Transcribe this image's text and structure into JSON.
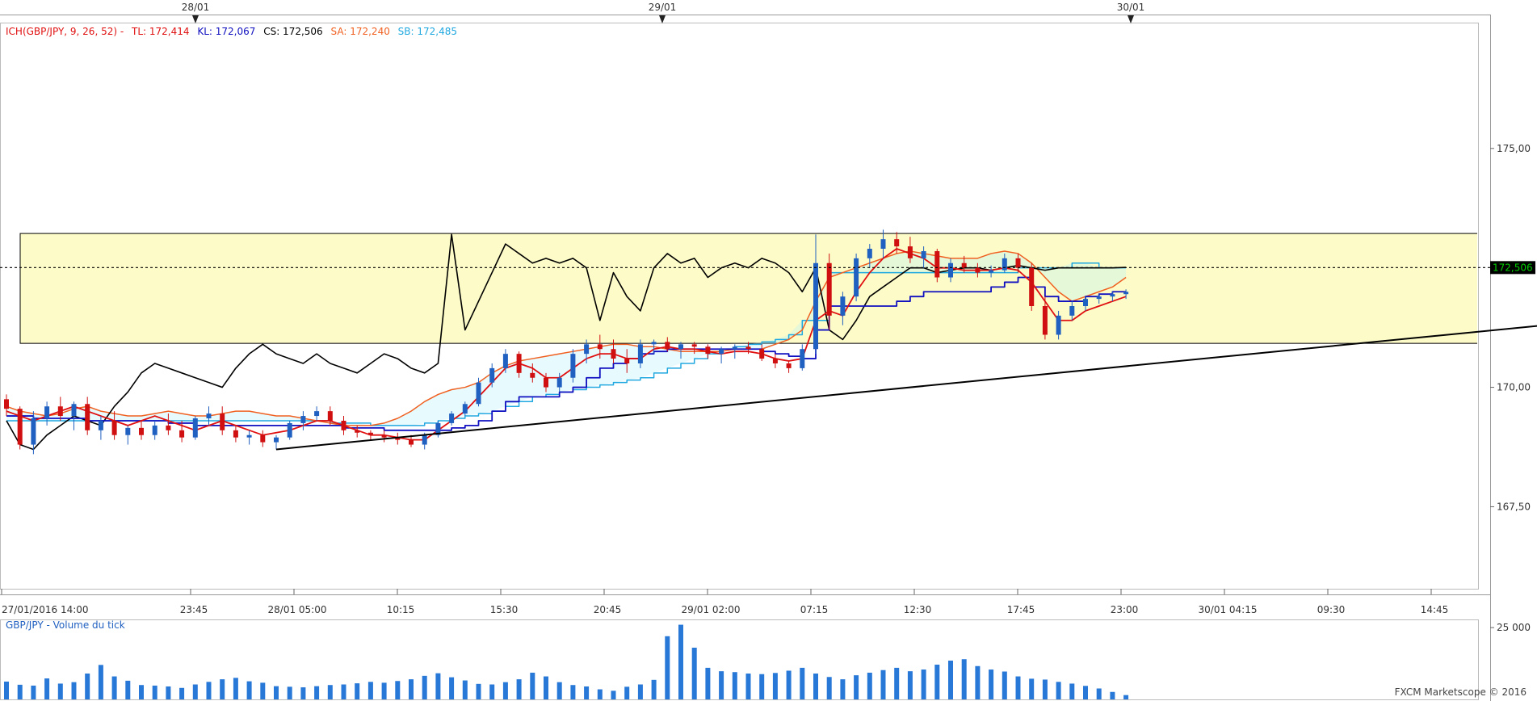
{
  "legend": {
    "ich": "ICH(GBP/JPY, 9, 26, 52) -",
    "tl": "TL: 172,414",
    "kl": "KL: 172,067",
    "cs": "CS: 172,506",
    "sa": "SA: 172,240",
    "sb": "SB: 172,485"
  },
  "colors": {
    "tenkan": "#e01010",
    "kijun": "#1010c0",
    "chikou": "#000000",
    "senkou_a": "#f06020",
    "senkou_b": "#20a8e0",
    "candle_up": "#2060c0",
    "candle_down": "#d01010",
    "zone_fill": "#fdfbc8",
    "price_tag": "#00cc00"
  },
  "volume_title": "GBP/JPY - Volume du tick",
  "credit": "FXCM Marketscope © 2016",
  "chart_data": {
    "type": "candlestick",
    "symbol": "GBP/JPY",
    "top_dates": [
      "28/01",
      "29/01",
      "30/01"
    ],
    "x_tick_labels": [
      "27/01/2016 14:00",
      "23:45",
      "28/01 05:00",
      "10:15",
      "15:30",
      "20:45",
      "29/01 02:00",
      "07:15",
      "12:30",
      "17:45",
      "23:00",
      "30/01 04:15",
      "09:30",
      "14:45"
    ],
    "y_tick_labels": [
      "175,00",
      "170,00",
      "167,50"
    ],
    "y_ticks": [
      175.0,
      170.0,
      167.5
    ],
    "ylim": [
      165.8,
      177.6
    ],
    "current_price": 172.506,
    "current_price_label": "172,506",
    "zone": [
      170.92,
      173.22
    ],
    "trendline": {
      "from": [
        20,
        168.7
      ],
      "to": [
        143,
        172.1
      ]
    },
    "candles": [
      [
        169.75,
        169.85,
        169.4,
        169.55
      ],
      [
        169.55,
        169.6,
        168.7,
        168.8
      ],
      [
        168.8,
        169.5,
        168.6,
        169.35
      ],
      [
        169.35,
        169.7,
        169.2,
        169.6
      ],
      [
        169.6,
        169.8,
        169.3,
        169.4
      ],
      [
        169.4,
        169.7,
        169.1,
        169.65
      ],
      [
        169.65,
        169.8,
        169.0,
        169.1
      ],
      [
        169.1,
        169.4,
        168.9,
        169.3
      ],
      [
        169.3,
        169.5,
        168.9,
        169.0
      ],
      [
        169.0,
        169.2,
        168.8,
        169.15
      ],
      [
        169.15,
        169.3,
        168.9,
        169.0
      ],
      [
        169.0,
        169.3,
        168.9,
        169.2
      ],
      [
        169.2,
        169.45,
        169.0,
        169.1
      ],
      [
        169.1,
        169.3,
        168.85,
        168.95
      ],
      [
        168.95,
        169.4,
        168.9,
        169.35
      ],
      [
        169.35,
        169.6,
        169.2,
        169.45
      ],
      [
        169.45,
        169.6,
        169.0,
        169.1
      ],
      [
        169.1,
        169.2,
        168.85,
        168.95
      ],
      [
        168.95,
        169.1,
        168.8,
        169.0
      ],
      [
        169.0,
        169.1,
        168.75,
        168.85
      ],
      [
        168.85,
        169.0,
        168.7,
        168.95
      ],
      [
        168.95,
        169.3,
        168.9,
        169.25
      ],
      [
        169.25,
        169.5,
        169.1,
        169.4
      ],
      [
        169.4,
        169.6,
        169.3,
        169.5
      ],
      [
        169.5,
        169.6,
        169.2,
        169.3
      ],
      [
        169.3,
        169.4,
        169.0,
        169.1
      ],
      [
        169.1,
        169.2,
        168.95,
        169.05
      ],
      [
        169.05,
        169.1,
        168.9,
        169.0
      ],
      [
        169.0,
        169.1,
        168.85,
        168.95
      ],
      [
        168.95,
        169.05,
        168.8,
        168.9
      ],
      [
        168.9,
        169.0,
        168.75,
        168.8
      ],
      [
        168.8,
        169.05,
        168.7,
        169.0
      ],
      [
        169.0,
        169.3,
        168.95,
        169.25
      ],
      [
        169.25,
        169.5,
        169.2,
        169.45
      ],
      [
        169.45,
        169.7,
        169.4,
        169.65
      ],
      [
        169.65,
        170.2,
        169.6,
        170.1
      ],
      [
        170.1,
        170.5,
        170.0,
        170.4
      ],
      [
        170.4,
        170.8,
        170.3,
        170.7
      ],
      [
        170.7,
        170.75,
        170.2,
        170.3
      ],
      [
        170.3,
        170.5,
        170.1,
        170.2
      ],
      [
        170.2,
        170.3,
        169.9,
        170.0
      ],
      [
        170.0,
        170.3,
        169.9,
        170.2
      ],
      [
        170.2,
        170.8,
        170.1,
        170.7
      ],
      [
        170.7,
        171.0,
        170.5,
        170.9
      ],
      [
        170.9,
        171.1,
        170.6,
        170.8
      ],
      [
        170.8,
        171.0,
        170.5,
        170.6
      ],
      [
        170.6,
        170.8,
        170.3,
        170.5
      ],
      [
        170.5,
        171.0,
        170.4,
        170.9
      ],
      [
        170.9,
        171.0,
        170.7,
        170.95
      ],
      [
        170.95,
        171.05,
        170.75,
        170.8
      ],
      [
        170.8,
        170.95,
        170.6,
        170.9
      ],
      [
        170.9,
        170.95,
        170.7,
        170.85
      ],
      [
        170.85,
        170.9,
        170.6,
        170.7
      ],
      [
        170.7,
        170.85,
        170.5,
        170.8
      ],
      [
        170.8,
        170.9,
        170.6,
        170.85
      ],
      [
        170.85,
        170.95,
        170.7,
        170.8
      ],
      [
        170.8,
        170.9,
        170.55,
        170.6
      ],
      [
        170.6,
        170.7,
        170.4,
        170.5
      ],
      [
        170.5,
        170.55,
        170.3,
        170.4
      ],
      [
        170.4,
        170.9,
        170.35,
        170.8
      ],
      [
        170.8,
        173.2,
        170.7,
        172.6
      ],
      [
        172.6,
        172.8,
        171.2,
        171.5
      ],
      [
        171.5,
        172.0,
        171.3,
        171.9
      ],
      [
        171.9,
        172.8,
        171.8,
        172.7
      ],
      [
        172.7,
        173.0,
        172.5,
        172.9
      ],
      [
        172.9,
        173.3,
        172.7,
        173.1
      ],
      [
        173.1,
        173.25,
        172.8,
        172.95
      ],
      [
        172.95,
        173.15,
        172.6,
        172.7
      ],
      [
        172.7,
        172.95,
        172.5,
        172.85
      ],
      [
        172.85,
        172.9,
        172.2,
        172.3
      ],
      [
        172.3,
        172.7,
        172.2,
        172.6
      ],
      [
        172.6,
        172.75,
        172.4,
        172.5
      ],
      [
        172.5,
        172.6,
        172.3,
        172.4
      ],
      [
        172.4,
        172.55,
        172.3,
        172.45
      ],
      [
        172.45,
        172.8,
        172.4,
        172.7
      ],
      [
        172.7,
        172.8,
        172.4,
        172.5
      ],
      [
        172.5,
        172.6,
        171.6,
        171.7
      ],
      [
        171.7,
        171.9,
        171.0,
        171.1
      ],
      [
        171.1,
        171.6,
        171.0,
        171.5
      ],
      [
        171.5,
        171.8,
        171.4,
        171.7
      ],
      [
        171.7,
        171.9,
        171.6,
        171.85
      ],
      [
        171.85,
        171.95,
        171.75,
        171.9
      ],
      [
        171.9,
        172.0,
        171.8,
        171.95
      ],
      [
        171.95,
        172.05,
        171.85,
        172.0
      ]
    ],
    "tenkan": [
      169.5,
      169.4,
      169.3,
      169.4,
      169.5,
      169.6,
      169.5,
      169.4,
      169.3,
      169.2,
      169.3,
      169.4,
      169.3,
      169.2,
      169.1,
      169.2,
      169.3,
      169.2,
      169.1,
      169.0,
      169.05,
      169.1,
      169.2,
      169.3,
      169.3,
      169.2,
      169.1,
      169.0,
      169.0,
      168.95,
      168.9,
      168.9,
      169.1,
      169.3,
      169.5,
      169.8,
      170.1,
      170.4,
      170.5,
      170.4,
      170.2,
      170.2,
      170.4,
      170.6,
      170.7,
      170.7,
      170.6,
      170.6,
      170.8,
      170.85,
      170.8,
      170.8,
      170.75,
      170.7,
      170.75,
      170.75,
      170.7,
      170.6,
      170.55,
      170.6,
      171.4,
      171.6,
      171.5,
      172.0,
      172.4,
      172.7,
      172.9,
      172.8,
      172.7,
      172.5,
      172.5,
      172.45,
      172.45,
      172.45,
      172.5,
      172.45,
      172.2,
      171.8,
      171.4,
      171.4,
      171.6,
      171.7,
      171.8,
      171.9
    ],
    "kijun": [
      169.4,
      169.4,
      169.35,
      169.35,
      169.35,
      169.35,
      169.3,
      169.3,
      169.3,
      169.3,
      169.3,
      169.3,
      169.25,
      169.25,
      169.2,
      169.2,
      169.2,
      169.2,
      169.2,
      169.2,
      169.2,
      169.2,
      169.2,
      169.2,
      169.2,
      169.15,
      169.15,
      169.15,
      169.1,
      169.1,
      169.1,
      169.1,
      169.1,
      169.15,
      169.2,
      169.3,
      169.5,
      169.7,
      169.8,
      169.8,
      169.8,
      169.9,
      170.0,
      170.2,
      170.4,
      170.5,
      170.6,
      170.7,
      170.75,
      170.8,
      170.8,
      170.8,
      170.8,
      170.8,
      170.8,
      170.8,
      170.75,
      170.7,
      170.65,
      170.6,
      171.2,
      171.7,
      171.7,
      171.7,
      171.7,
      171.7,
      171.8,
      171.9,
      172.0,
      172.0,
      172.0,
      172.0,
      172.0,
      172.1,
      172.2,
      172.3,
      172.1,
      171.9,
      171.8,
      171.8,
      171.9,
      171.95,
      172.0,
      172.0
    ],
    "chikou": [
      169.3,
      168.8,
      168.7,
      169.0,
      169.2,
      169.4,
      169.3,
      169.2,
      169.6,
      169.9,
      170.3,
      170.5,
      170.4,
      170.3,
      170.2,
      170.1,
      170.0,
      170.4,
      170.7,
      170.9,
      170.7,
      170.6,
      170.5,
      170.7,
      170.5,
      170.4,
      170.3,
      170.5,
      170.7,
      170.6,
      170.4,
      170.3,
      170.5,
      173.2,
      171.2,
      171.8,
      172.4,
      173.0,
      172.8,
      172.6,
      172.7,
      172.6,
      172.7,
      172.5,
      171.4,
      172.4,
      171.9,
      171.6,
      172.5,
      172.8,
      172.6,
      172.7,
      172.3,
      172.5,
      172.6,
      172.5,
      172.7,
      172.6,
      172.4,
      172.0,
      172.5,
      171.2,
      171.0,
      171.4,
      171.9,
      172.1,
      172.3,
      172.5,
      172.5,
      172.4,
      172.45,
      172.5,
      172.5,
      172.45,
      172.5,
      172.55,
      172.5,
      172.45,
      172.5,
      172.5,
      172.5,
      172.5,
      172.5,
      172.51
    ],
    "senkou_a": [
      169.6,
      169.5,
      169.45,
      169.4,
      169.45,
      169.55,
      169.6,
      169.5,
      169.45,
      169.4,
      169.4,
      169.45,
      169.5,
      169.45,
      169.4,
      169.4,
      169.45,
      169.5,
      169.5,
      169.45,
      169.4,
      169.4,
      169.35,
      169.3,
      169.25,
      169.2,
      169.2,
      169.2,
      169.25,
      169.35,
      169.5,
      169.7,
      169.85,
      169.95,
      170.0,
      170.1,
      170.3,
      170.45,
      170.55,
      170.6,
      170.65,
      170.7,
      170.75,
      170.8,
      170.85,
      170.9,
      170.9,
      170.85,
      170.85,
      170.8,
      170.75,
      170.75,
      170.75,
      170.75,
      170.8,
      170.8,
      170.8,
      170.9,
      171.0,
      171.2,
      171.8,
      172.3,
      172.4,
      172.5,
      172.6,
      172.7,
      172.8,
      172.85,
      172.8,
      172.75,
      172.7,
      172.7,
      172.7,
      172.8,
      172.85,
      172.8,
      172.6,
      172.3,
      172.0,
      171.8,
      171.9,
      172.0,
      172.1,
      172.3
    ],
    "senkou_b": [
      169.3,
      169.3,
      169.3,
      169.3,
      169.3,
      169.3,
      169.3,
      169.3,
      169.3,
      169.3,
      169.3,
      169.3,
      169.3,
      169.3,
      169.3,
      169.3,
      169.3,
      169.3,
      169.3,
      169.3,
      169.3,
      169.3,
      169.3,
      169.3,
      169.25,
      169.25,
      169.25,
      169.2,
      169.2,
      169.2,
      169.2,
      169.25,
      169.3,
      169.35,
      169.4,
      169.45,
      169.5,
      169.6,
      169.7,
      169.8,
      169.85,
      169.9,
      169.95,
      170.0,
      170.05,
      170.1,
      170.15,
      170.2,
      170.3,
      170.4,
      170.5,
      170.6,
      170.7,
      170.8,
      170.85,
      170.9,
      170.95,
      171.0,
      171.1,
      171.4,
      171.4,
      172.4,
      172.4,
      172.4,
      172.4,
      172.4,
      172.4,
      172.4,
      172.4,
      172.4,
      172.4,
      172.4,
      172.4,
      172.4,
      172.4,
      172.5,
      172.5,
      172.5,
      172.5,
      172.6,
      172.6,
      172.5,
      172.5,
      172.5
    ],
    "volume_ylim": [
      0,
      27000
    ],
    "volume_tick_labels": [
      "25 000"
    ],
    "volume_ticks": [
      25000
    ],
    "volume": [
      6200,
      5100,
      4800,
      7300,
      5500,
      6000,
      9000,
      12000,
      8000,
      6500,
      5000,
      4800,
      4500,
      4000,
      5200,
      6100,
      7000,
      7500,
      6300,
      5800,
      4600,
      4400,
      4200,
      4600,
      5000,
      5200,
      5600,
      6100,
      5800,
      6400,
      7000,
      8200,
      9100,
      7700,
      6600,
      5400,
      5200,
      6000,
      7000,
      9300,
      8000,
      6000,
      5000,
      4500,
      3500,
      3000,
      4400,
      5200,
      6800,
      22000,
      26000,
      18000,
      11000,
      9800,
      9500,
      9000,
      8800,
      9200,
      10000,
      11000,
      9000,
      7800,
      7000,
      8400,
      9300,
      10200,
      11000,
      9800,
      10400,
      12100,
      13500,
      14000,
      11600,
      10400,
      9700,
      8000,
      7200,
      6900,
      6100,
      5500,
      4700,
      3800,
      2600,
      1500
    ]
  }
}
